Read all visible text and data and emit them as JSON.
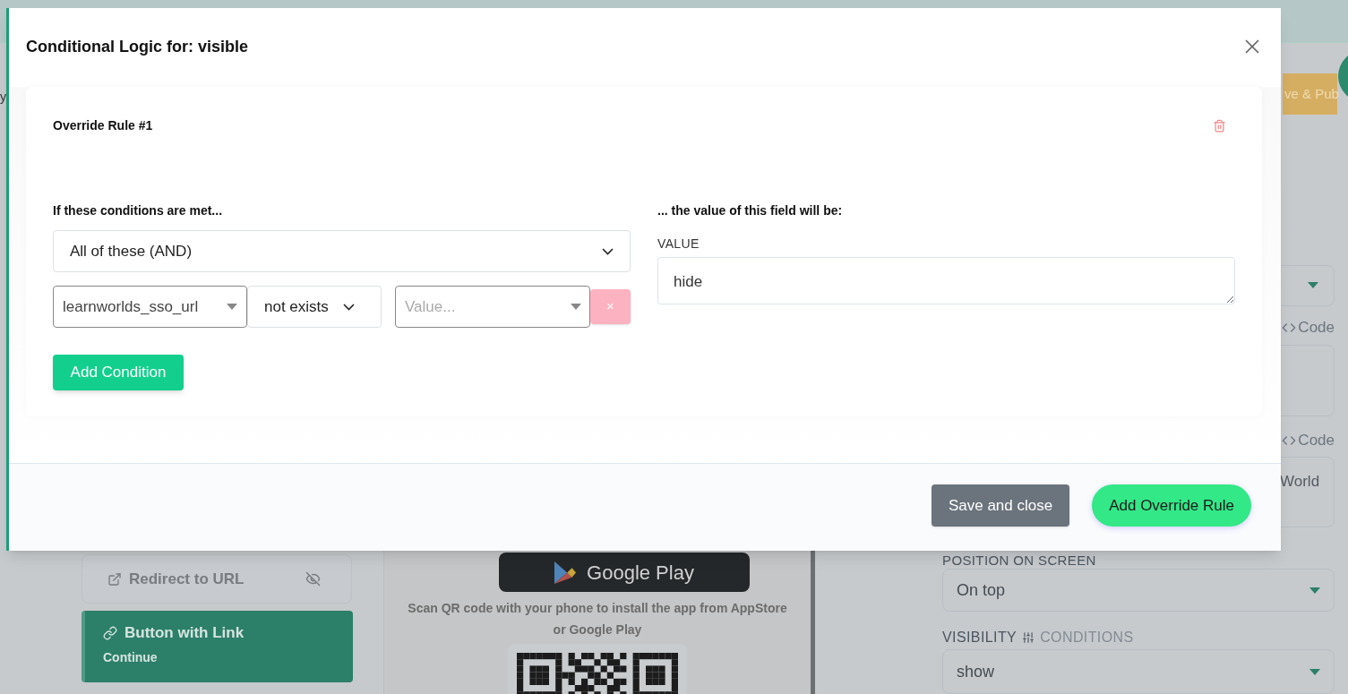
{
  "background": {
    "fragment": "y",
    "publish_button": "ve & Pub",
    "items": [
      {
        "label": "Redirect to URL",
        "kind": "redirect",
        "hidden": true,
        "selected": false
      },
      {
        "label": "Button with Link",
        "subtitle": "Continue",
        "kind": "link",
        "hidden": false,
        "selected": true
      }
    ],
    "store_badge": "Google Play",
    "scan_text": "Scan QR code with your phone to install the app from AppStore or Google Play",
    "settings": {
      "code_labels": [
        "Code",
        "Code"
      ],
      "text_value": "World",
      "position_label": "POSITION ON SCREEN",
      "position_value": "On top",
      "visibility_label": "VISIBILITY",
      "conditions_link": "CONDITIONS",
      "visibility_value": "show"
    }
  },
  "modal": {
    "title": "Conditional Logic for: visible",
    "rules": [
      {
        "title": "Override Rule #1",
        "conditions_label": "If these conditions are met...",
        "match": "All of these (AND)",
        "conditions": [
          {
            "field": "learnworlds_sso_url",
            "operator": "not exists",
            "value_placeholder": "Value...",
            "remove": "×"
          }
        ],
        "add_condition": "Add Condition",
        "result_label": "... the value of this field will be:",
        "value_label": "VALUE",
        "value": "hide"
      }
    ],
    "buttons": [
      {
        "label": "Save and close",
        "kind": "secondary"
      },
      {
        "label": "Add Override Rule",
        "kind": "primary"
      }
    ]
  }
}
